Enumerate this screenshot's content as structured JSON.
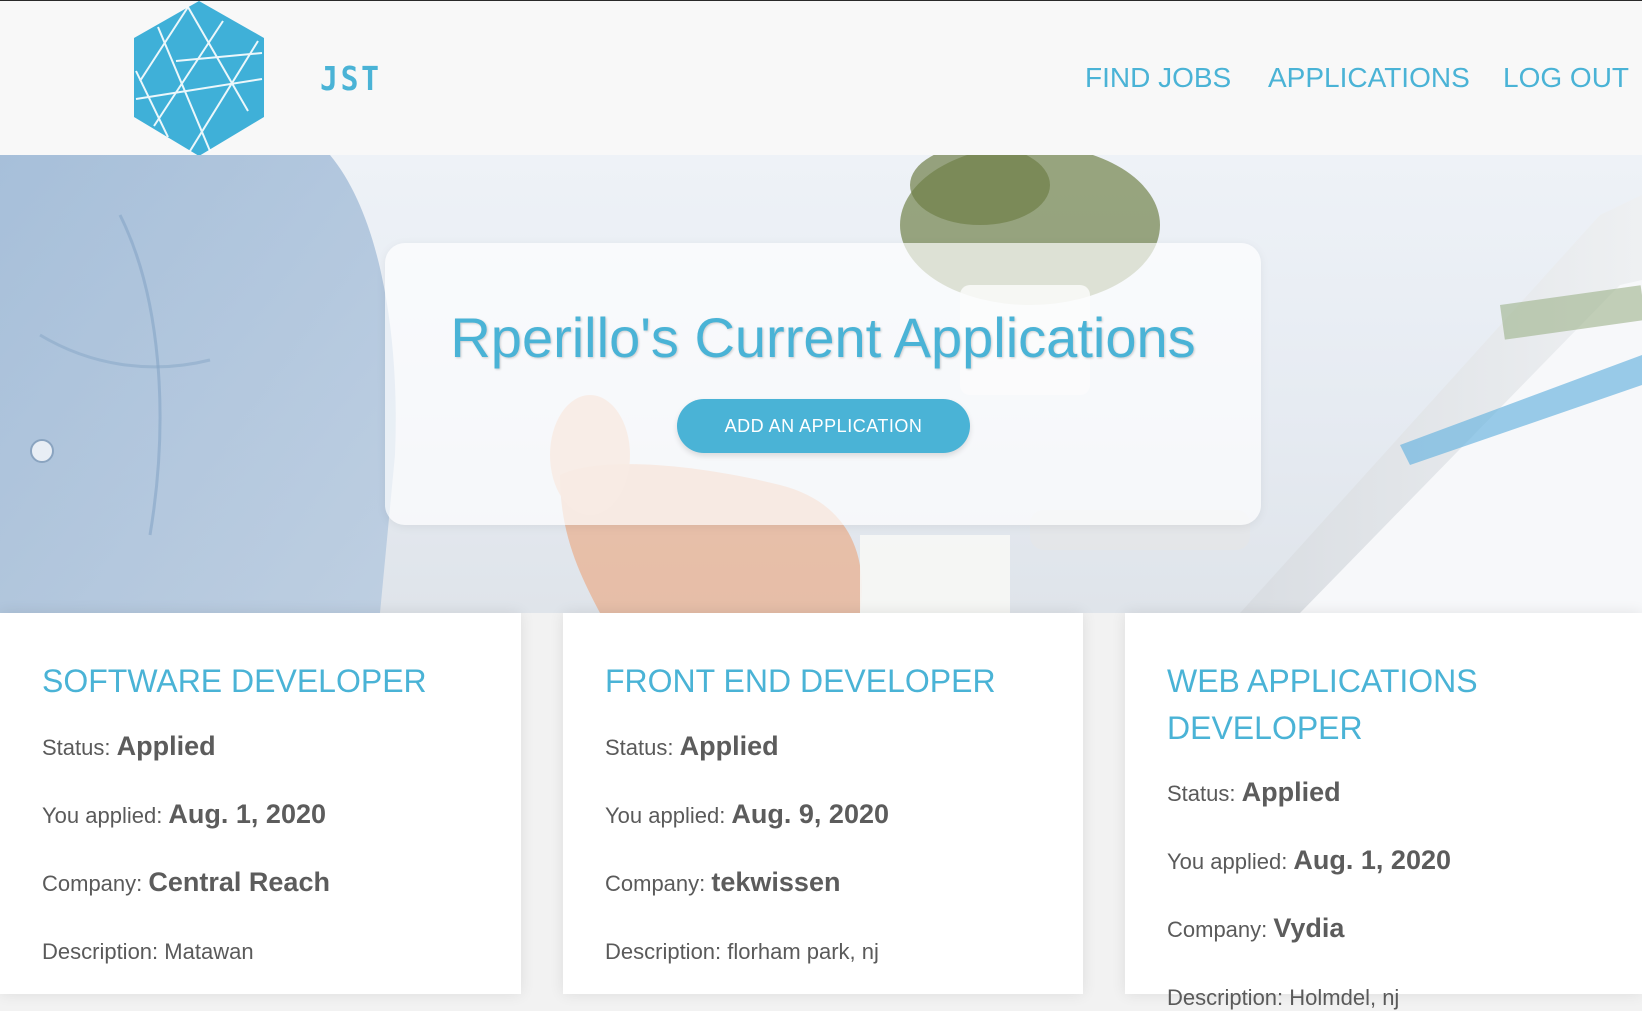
{
  "brand": {
    "name": "JST",
    "accent": "#4ab3d6"
  },
  "nav": {
    "find_jobs": "FIND JOBS",
    "applications": "APPLICATIONS",
    "log_out": "LOG OUT"
  },
  "hero": {
    "title": "Rperillo's Current Applications",
    "add_button": "ADD AN APPLICATION"
  },
  "labels": {
    "status": "Status:",
    "applied": "You applied:",
    "company": "Company:",
    "description": "Description:"
  },
  "applications": [
    {
      "title": "SOFTWARE DEVELOPER",
      "status": "Applied",
      "date": "Aug. 1, 2020",
      "company": "Central Reach",
      "description": "Matawan"
    },
    {
      "title": "FRONT END DEVELOPER",
      "status": "Applied",
      "date": "Aug. 9, 2020",
      "company": "tekwissen",
      "description": "florham park, nj"
    },
    {
      "title": "WEB APPLICATIONS DEVELOPER",
      "status": "Applied",
      "date": "Aug. 1, 2020",
      "company": "Vydia",
      "description": "Holmdel, nj"
    }
  ]
}
